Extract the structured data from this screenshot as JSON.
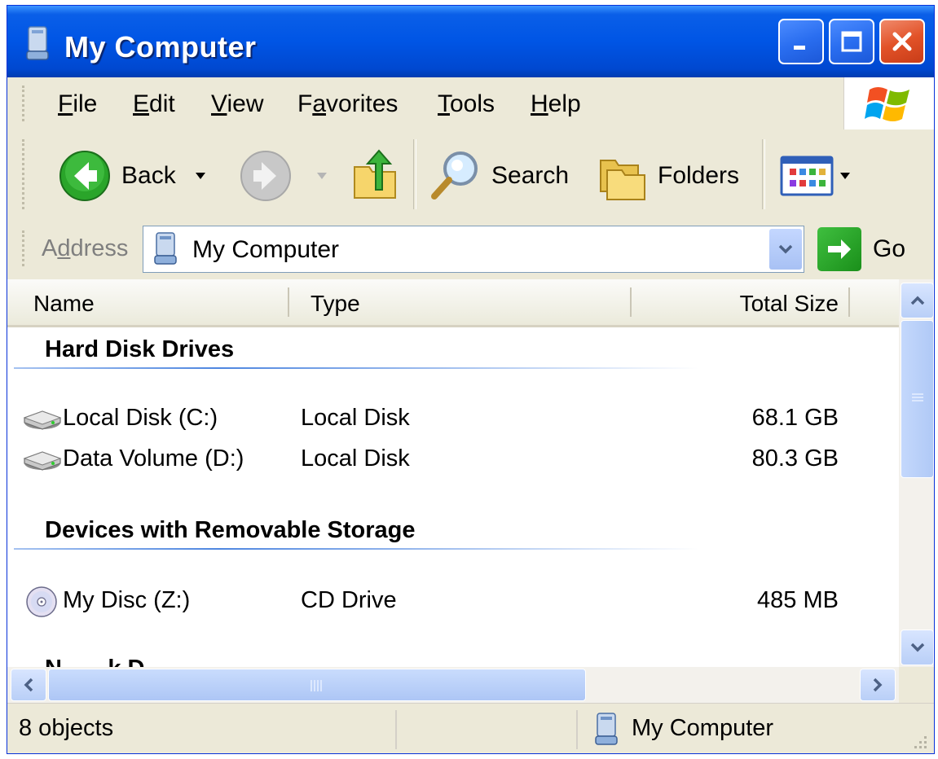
{
  "window": {
    "title": "My Computer",
    "title_bar_color": "#0055e5"
  },
  "menu": {
    "items": [
      {
        "accel": "F",
        "rest": "ile"
      },
      {
        "accel": "E",
        "rest": "dit"
      },
      {
        "accel": "V",
        "rest": "iew"
      },
      {
        "pre": "F",
        "accel": "a",
        "rest": "vorites"
      },
      {
        "accel": "T",
        "rest": "ools"
      },
      {
        "accel": "H",
        "rest": "elp"
      }
    ]
  },
  "toolbar": {
    "back_label": "Back",
    "search_label": "Search",
    "folders_label": "Folders"
  },
  "address": {
    "label_pre": "A",
    "label_accel": "d",
    "label_rest": "dress",
    "value": "My Computer",
    "go_label": "Go"
  },
  "columns": {
    "name": "Name",
    "type": "Type",
    "total_size": "Total Size"
  },
  "groups": [
    {
      "title": "Hard Disk Drives",
      "items": [
        {
          "name": "Local Disk (C:)",
          "type": "Local Disk",
          "size": "68.1 GB",
          "icon": "hard-drive-icon"
        },
        {
          "name": "Data Volume (D:)",
          "type": "Local Disk",
          "size": "80.3 GB",
          "icon": "hard-drive-icon"
        }
      ]
    },
    {
      "title": "Devices with Removable Storage",
      "items": [
        {
          "name": "My Disc (Z:)",
          "type": "CD Drive",
          "size": "485 MB",
          "icon": "cd-drive-icon"
        }
      ]
    }
  ],
  "status": {
    "objects": "8 objects",
    "location": "My Computer"
  }
}
